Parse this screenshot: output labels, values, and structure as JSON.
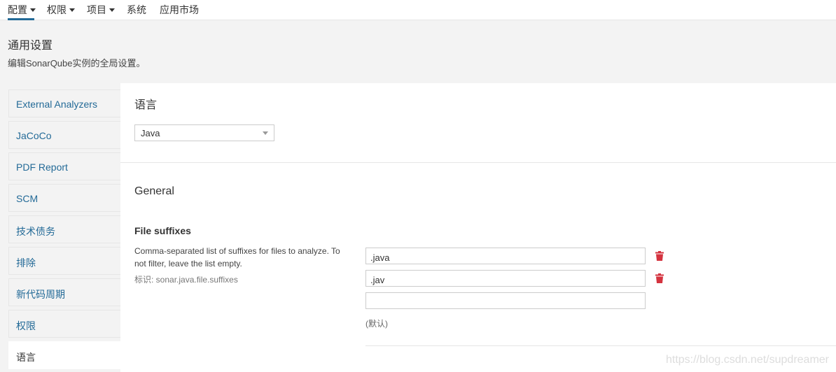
{
  "nav": {
    "items": [
      {
        "label": "配置",
        "dropdown": true
      },
      {
        "label": "权限",
        "dropdown": true
      },
      {
        "label": "项目",
        "dropdown": true
      },
      {
        "label": "系统",
        "dropdown": false
      },
      {
        "label": "应用市场",
        "dropdown": false
      }
    ],
    "active": "配置"
  },
  "header": {
    "title": "通用设置",
    "description": "编辑SonarQube实例的全局设置。"
  },
  "sidebar": {
    "items": [
      {
        "label": "External Analyzers"
      },
      {
        "label": "JaCoCo"
      },
      {
        "label": "PDF Report"
      },
      {
        "label": "SCM"
      },
      {
        "label": "技术债务"
      },
      {
        "label": "排除"
      },
      {
        "label": "新代码周期"
      },
      {
        "label": "权限"
      },
      {
        "label": "语言",
        "active": true
      }
    ]
  },
  "main": {
    "language_label": "语言",
    "language_select": {
      "value": "Java"
    },
    "section_title": "General",
    "setting": {
      "name": "File suffixes",
      "description": "Comma-separated list of suffixes for files to analyze. To not filter, leave the list empty.",
      "key": "标识: sonar.java.file.suffixes",
      "values": [
        ".java",
        ".jav",
        ""
      ],
      "default_label": "(默认)"
    }
  },
  "watermark": "https://blog.csdn.net/supdreamer",
  "colors": {
    "accent": "#236a97",
    "delete_icon": "#d4333f",
    "background": "#f3f3f3"
  }
}
